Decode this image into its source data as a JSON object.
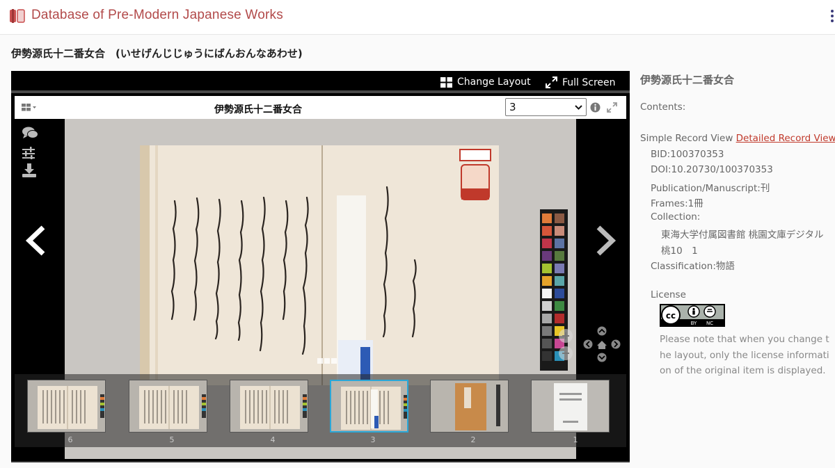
{
  "header": {
    "site_title": "Database of Pre-Modern Japanese Works",
    "icon": "book-scroll-icon",
    "brand_color": "#b24a4a"
  },
  "work": {
    "title": "伊勢源氏十二番女合　(いせげんじじゅうにばんおんなあわせ)"
  },
  "viewer": {
    "change_layout_label": "Change Layout",
    "full_screen_label": "Full Screen",
    "toolbar_title": "伊勢源氏十二番女合",
    "frame_select_value": "3",
    "thumbnails": [
      {
        "label": "6",
        "active": false
      },
      {
        "label": "5",
        "active": false
      },
      {
        "label": "4",
        "active": false
      },
      {
        "label": "3",
        "active": true
      },
      {
        "label": "2",
        "active": false
      },
      {
        "label": "1",
        "active": false
      }
    ],
    "colors": {
      "active_thumb_border": "#2aa7d8"
    }
  },
  "panel": {
    "title": "伊勢源氏十二番女合",
    "contents_label": "Contents:",
    "simple_view": "Simple Record View",
    "detailed_view": "Detailed Record View",
    "bid": "BID:100370353",
    "doi": "DOI:10.20730/100370353",
    "publication": "Publication/Manuscript:刊",
    "frames": "Frames:1冊",
    "collection_label": "Collection:",
    "collection_line1": "東海大学付属図書館 桃園文庫デジタル",
    "collection_line2": "桃10　1",
    "classification": "Classification:物語",
    "license_label": "License",
    "license_note": "Please note that when you change the layout, only the license information of the original item is displayed."
  }
}
